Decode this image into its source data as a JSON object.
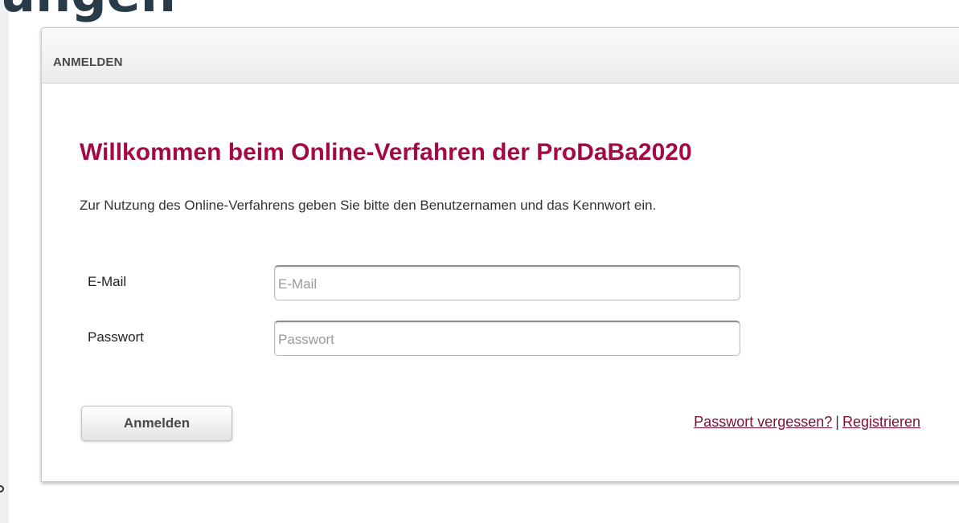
{
  "background": {
    "heading_fragment": "ungen"
  },
  "panel": {
    "title": "ANMELDEN",
    "welcome": "Willkommen beim Online-Verfahren der ProDaBa2020",
    "intro": "Zur Nutzung des Online-Verfahrens geben Sie bitte den Benutzernamen und das Kennwort ein."
  },
  "form": {
    "email_label": "E-Mail",
    "email_placeholder": "E-Mail",
    "email_value": "",
    "password_label": "Passwort",
    "password_placeholder": "Passwort",
    "password_value": "",
    "submit_label": "Anmelden"
  },
  "links": {
    "forgot_password": "Passwort vergessen?",
    "separator": "|",
    "register": "Registrieren"
  },
  "colors": {
    "accent": "#a30a45",
    "link": "#7d1030",
    "heading_bg": "#283b49"
  }
}
